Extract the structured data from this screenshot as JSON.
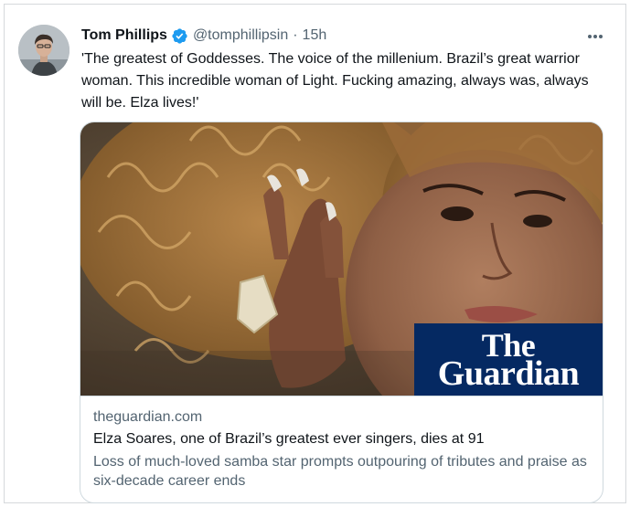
{
  "author": {
    "name": "Tom Phillips",
    "handle": "@tomphillipsin",
    "separator": "·",
    "time": "15h",
    "verified": true
  },
  "tweet": {
    "text": "'The greatest of Goddesses. The voice of the millenium. Brazil’s great warrior woman. This incredible woman of Light. Fucking amazing, always was, always will be. Elza lives!'"
  },
  "card": {
    "logo_line1": "The",
    "logo_line2": "Guardian",
    "domain": "theguardian.com",
    "title": "Elza Soares, one of Brazil’s greatest ever singers, dies at 91",
    "description": "Loss of much-loved samba star prompts outpouring of tributes and praise as six-decade career ends"
  },
  "colors": {
    "verified_blue": "#1d9bf0",
    "guardian_blue": "#052962",
    "secondary_text": "#536471"
  },
  "icons": {
    "more": "more-horizontal-icon",
    "verified": "verified-badge-icon"
  }
}
